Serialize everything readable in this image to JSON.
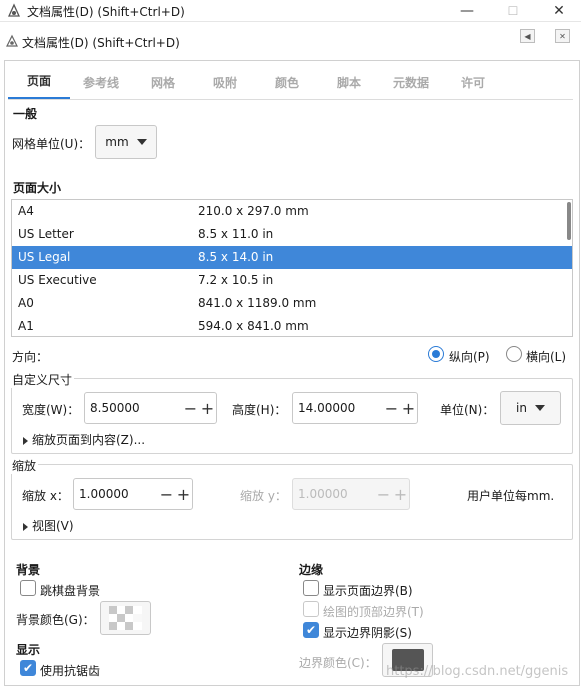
{
  "window": {
    "title": "文档属性(D) (Shift+Ctrl+D)",
    "minimize": "—",
    "maximize": "☐",
    "close": "✕"
  },
  "dock": {
    "title": "文档属性(D) (Shift+Ctrl+D)",
    "btn_left": "◀",
    "btn_close": "✕"
  },
  "tabs": [
    "页面",
    "参考线",
    "网格",
    "吸附",
    "颜色",
    "脚本",
    "元数据",
    "许可"
  ],
  "general": {
    "heading": "一般",
    "grid_unit_label": "网格单位(U)：",
    "grid_unit_value": "mm"
  },
  "page_size": {
    "heading": "页面大小",
    "rows": [
      {
        "name": "A4",
        "size": "210.0 x 297.0 mm"
      },
      {
        "name": "US Letter",
        "size": "8.5 x 11.0 in"
      },
      {
        "name": "US Legal",
        "size": "8.5 x 14.0 in"
      },
      {
        "name": "US Executive",
        "size": "7.2 x 10.5 in"
      },
      {
        "name": "A0",
        "size": "841.0 x 1189.0 mm"
      },
      {
        "name": "A1",
        "size": "594.0 x 841.0 mm"
      }
    ],
    "selected": "US Legal"
  },
  "orientation": {
    "label": "方向：",
    "portrait": "纵向(P)",
    "landscape": "横向(L)"
  },
  "custom_size": {
    "heading": "自定义尺寸",
    "width_label": "宽度(W)：",
    "width_value": "8.50000",
    "height_label": "高度(H)：",
    "height_value": "14.00000",
    "unit_label": "单位(N)：",
    "unit_value": "in",
    "resize_expander": "缩放页面到内容(Z)..."
  },
  "scale": {
    "heading": "缩放",
    "scale_x_label": "缩放 x：",
    "scale_x_value": "1.00000",
    "scale_y_label": "缩放 y：",
    "scale_y_value": "1.00000",
    "user_units": "用户单位每mm.",
    "viewbox_expander": "视图(V)"
  },
  "background": {
    "heading": "背景",
    "checkerboard": "跳棋盘背景",
    "color_label": "背景颜色(G)："
  },
  "display": {
    "heading": "显示",
    "antialias": "使用抗锯齿"
  },
  "border": {
    "heading": "边缘",
    "show_border": "显示页面边界(B)",
    "border_on_top": "绘图的顶部边界(T)",
    "show_shadow": "显示边界阴影(S)",
    "color_label": "边界颜色(C)：",
    "color": "#555555"
  },
  "colors": {
    "accent": "#2b7bd6",
    "selection": "#3f87d9"
  },
  "watermark": "https://blog.csdn.net/ggenis"
}
